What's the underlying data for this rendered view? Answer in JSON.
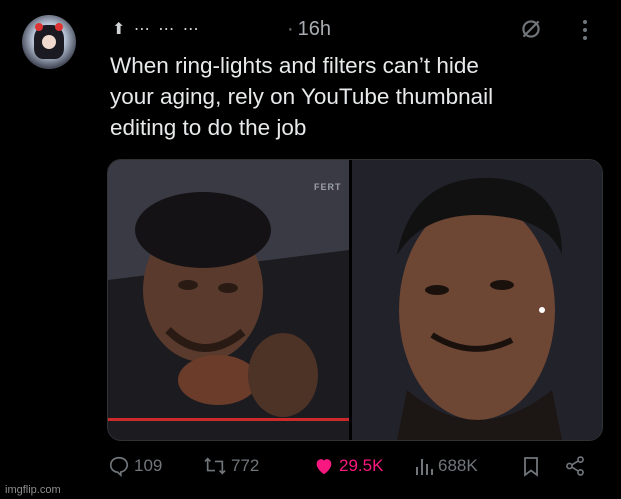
{
  "post": {
    "handle": "⬆ ⋯ ⋯ ⋯",
    "time": "16h",
    "dot": "·",
    "text": "When ring-lights and filters can’t hide\nyour aging, rely on YouTube thumbnail\nediting to do the job",
    "media_watermark": "FERT"
  },
  "actions": {
    "replies": "109",
    "reposts": "772",
    "likes": "29.5K",
    "views": "688K"
  },
  "footer": {
    "watermark": "imgflip.com"
  },
  "colors": {
    "like": "#f91880",
    "muted": "#71767b"
  },
  "icons": [
    "grok-icon",
    "more-icon",
    "reply-icon",
    "repost-icon",
    "heart-icon",
    "views-icon",
    "bookmark-icon",
    "share-icon"
  ]
}
